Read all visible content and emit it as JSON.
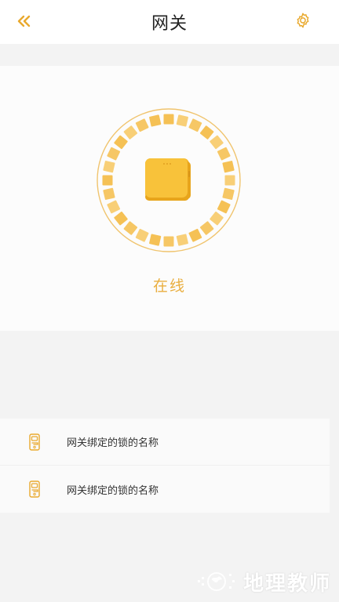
{
  "header": {
    "title": "网关",
    "back_icon": "double-chevron-left-icon",
    "settings_icon": "gear-icon"
  },
  "gateway": {
    "status": "在线",
    "icon": "gateway-device-icon"
  },
  "locks": [
    {
      "name": "网关绑定的锁的名称",
      "icon": "door-lock-icon"
    },
    {
      "name": "网关绑定的锁的名称",
      "icon": "door-lock-icon"
    }
  ],
  "watermark": {
    "text": "地理教师"
  },
  "colors": {
    "accent": "#e9ae3f",
    "ring_tile": "#f6c765",
    "device": "#f6b92c",
    "background": "#f3f3f3"
  }
}
